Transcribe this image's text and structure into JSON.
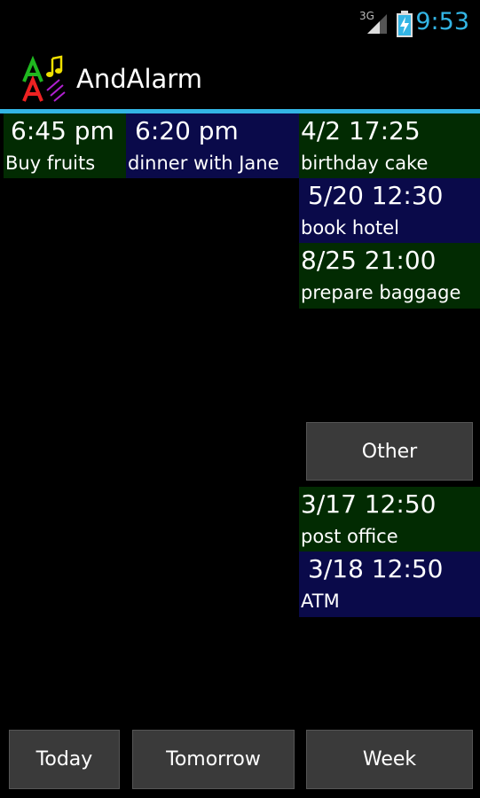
{
  "status": {
    "network": "3G",
    "time": "9:53"
  },
  "app": {
    "title": "AndAlarm"
  },
  "today_alarms": [
    {
      "time": "6:45 pm",
      "label": "Buy fruits"
    }
  ],
  "tomorrow_alarms": [
    {
      "time": "6:20 pm",
      "label": "dinner with Jane"
    }
  ],
  "week_alarms": [
    {
      "time": "4/2 17:25",
      "label": "birthday cake"
    },
    {
      "time": "5/20 12:30",
      "label": "book hotel"
    },
    {
      "time": "8/25 21:00",
      "label": "prepare baggage"
    }
  ],
  "other_button": "Other",
  "other_alarms": [
    {
      "time": "3/17 12:50",
      "label": "post office"
    },
    {
      "time": "3/18 12:50",
      "label": "ATM"
    }
  ],
  "bottom_buttons": {
    "today": "Today",
    "tomorrow": "Tomorrow",
    "week": "Week"
  },
  "colors": {
    "accent": "#33b5e5",
    "green_cell": "#022b02",
    "blue_cell": "#0a0a4a"
  }
}
